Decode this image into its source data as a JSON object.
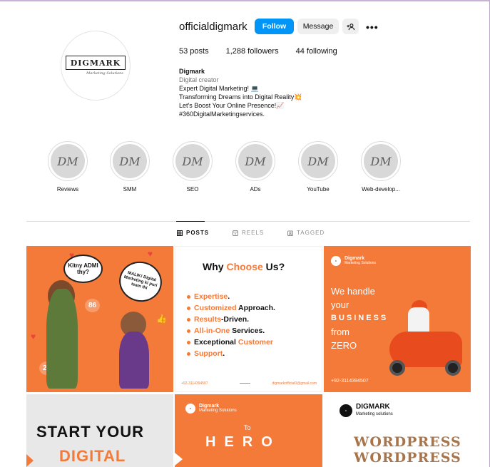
{
  "profile": {
    "username": "officialdigmark",
    "follow_label": "Follow",
    "message_label": "Message",
    "avatar_logo": "DIGMARK",
    "avatar_tagline": "Marketing Solutions"
  },
  "stats": {
    "posts": "53 posts",
    "followers": "1,288 followers",
    "following": "44 following"
  },
  "bio": {
    "name": "Digmark",
    "category": "Digital creator",
    "lines": [
      "Expert Digital Marketing! 💻",
      "Transforming Dreams into Digital Reality💥",
      "Let's Boost Your Online Presence!📈",
      "#360DigitalMarketingservices."
    ]
  },
  "highlights": [
    {
      "label": "Reviews",
      "mark": "DM"
    },
    {
      "label": "SMM",
      "mark": "DM"
    },
    {
      "label": "SEO",
      "mark": "DM"
    },
    {
      "label": "ADs",
      "mark": "DM"
    },
    {
      "label": "YouTube",
      "mark": "DM"
    },
    {
      "label": "Web-develop...",
      "mark": "DM"
    }
  ],
  "tabs": {
    "posts": "POSTS",
    "reels": "REELS",
    "tagged": "TAGGED"
  },
  "posts": {
    "p1": {
      "bubble1": "Kitny ADMI thy?",
      "bubble2": "MALIK! Digital Marketing ki puri team thi",
      "badge": "86",
      "badge2": "25"
    },
    "p2": {
      "title_a": "Why ",
      "title_b": "Choose",
      "title_c": " Us?",
      "items": [
        {
          "a": "Expertise",
          "b": "."
        },
        {
          "a": "Customized",
          "b": " Approach."
        },
        {
          "a": "Results",
          "b": "-Driven."
        },
        {
          "a": "All-in-One",
          "b": " Services."
        },
        {
          "a": "Exceptional ",
          "b": "Customer"
        },
        {
          "a": "Support",
          "b": "."
        }
      ],
      "phone": "+92-3114394507",
      "email": "digmarkofficial0@gmail.com"
    },
    "p3": {
      "brand": "Digmark",
      "brand_sub": "Marketing Solutions",
      "line1": "We handle",
      "line2": "your",
      "line3": "BUSINESS",
      "line4": "from",
      "line5": "ZERO",
      "phone": "+92-3114394507"
    },
    "p4": {
      "line1": "START YOUR",
      "line2": "DIGITAL"
    },
    "p5": {
      "brand": "Digmark",
      "brand_sub": "Marketing Solutions",
      "to": "To",
      "hero": "HERO"
    },
    "p6": {
      "brand": "DIGMARK",
      "brand_sub": "Marketing solutions",
      "line1": "WORDPRESS",
      "line2": "WORDPRESS"
    }
  }
}
